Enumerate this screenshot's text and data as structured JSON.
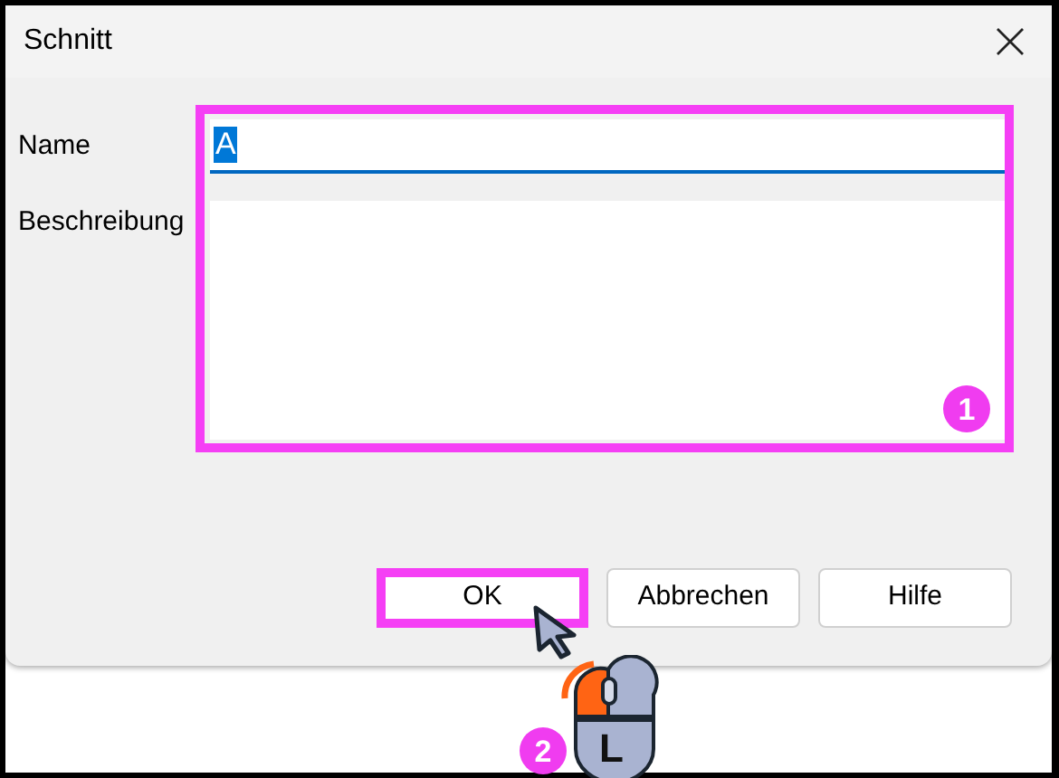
{
  "window": {
    "title": "Schnitt"
  },
  "fields": [
    {
      "kind": "input",
      "label": "Name",
      "value": "A",
      "value_selected": true
    },
    {
      "kind": "textarea",
      "label": "Beschreibung"
    }
  ],
  "fields_highlight": {
    "highlighted": true,
    "marker": "1"
  },
  "buttons": [
    {
      "label": "OK",
      "highlighted": true
    },
    {
      "label": "Abbrechen",
      "highlighted": false
    },
    {
      "label": "Hilfe",
      "highlighted": false
    }
  ],
  "mouse_hint": {
    "marker": "2",
    "key": "L",
    "left_pressed": true
  }
}
